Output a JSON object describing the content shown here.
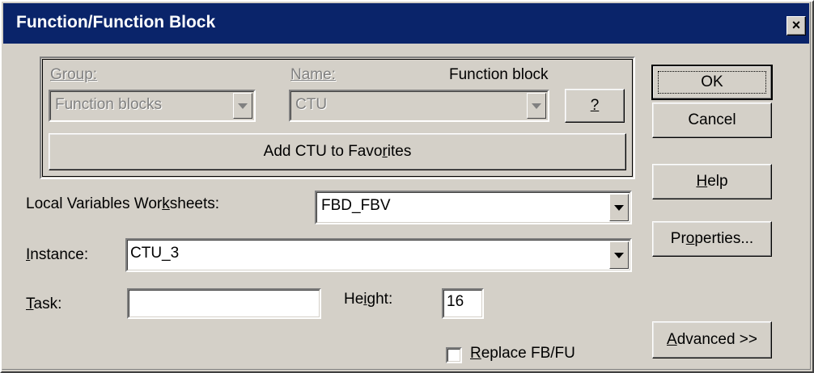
{
  "window": {
    "title": "Function/Function Block",
    "close_glyph": "×"
  },
  "selector": {
    "group_label": "Group:",
    "group_value": "Function blocks",
    "name_label": "Name:",
    "name_value": "CTU",
    "type_label": "Function block",
    "help_button": "?",
    "favorites_button_pre": "Add CTU to Favo",
    "favorites_button_key": "r",
    "favorites_button_post": "ites"
  },
  "form": {
    "worksheets_label_pre": "Local Variables Wor",
    "worksheets_label_key": "k",
    "worksheets_label_post": "sheets:",
    "worksheets_value": "FBD_FBV",
    "instance_label_key": "I",
    "instance_label_post": "nstance:",
    "instance_value": "CTU_3",
    "task_label_key": "T",
    "task_label_post": "ask:",
    "task_value": "",
    "height_label_pre": "He",
    "height_label_key": "i",
    "height_label_post": "ght:",
    "height_value": "16",
    "replace_label_key": "R",
    "replace_label_post": "eplace FB/FU",
    "replace_checked": false
  },
  "buttons": {
    "ok": "OK",
    "cancel": "Cancel",
    "help_key": "H",
    "help_post": "elp",
    "properties_pre": "Pr",
    "properties_key": "o",
    "properties_post": "perties...",
    "advanced_key": "A",
    "advanced_post": "dvanced >>"
  },
  "colors": {
    "titlebar": "#0a246a",
    "face": "#d4d0c8",
    "disabled_text": "#808080"
  }
}
